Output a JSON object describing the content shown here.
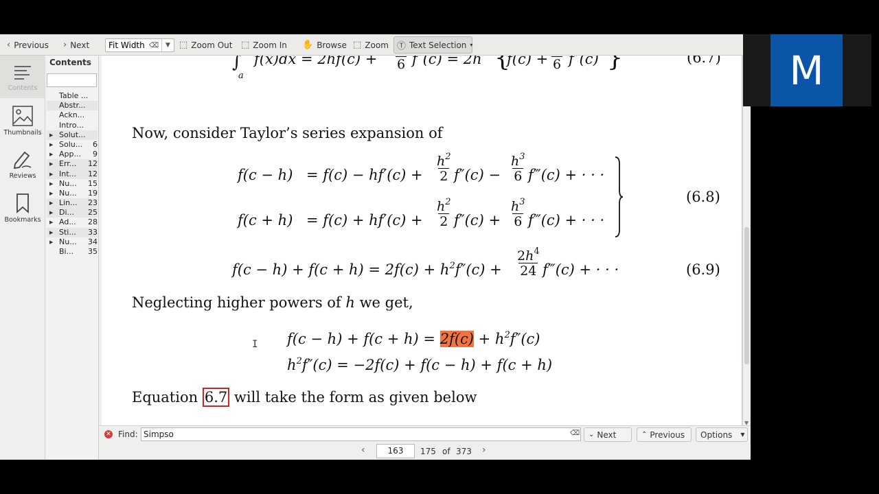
{
  "toolbar": {
    "previous": "Previous",
    "next": "Next",
    "zoom_mode": "Fit Width",
    "zoom_out": "Zoom Out",
    "zoom_in": "Zoom In",
    "browse": "Browse",
    "zoom": "Zoom",
    "text_selection": "Text Selection"
  },
  "sidebar": {
    "contents_icon_label": "Contents",
    "thumbnails": "Thumbnails",
    "reviews": "Reviews",
    "bookmarks": "Bookmarks"
  },
  "contents_panel": {
    "title": "Contents",
    "items": [
      {
        "label": "Table ...",
        "page": "",
        "expandable": false
      },
      {
        "label": "Abstr...",
        "page": "",
        "expandable": false
      },
      {
        "label": "Ackn...",
        "page": "",
        "expandable": false
      },
      {
        "label": "Intro...",
        "page": "",
        "expandable": false
      },
      {
        "label": "Solut...",
        "page": "",
        "expandable": true
      },
      {
        "label": "Solu...",
        "page": "6",
        "expandable": true
      },
      {
        "label": "App...",
        "page": "9",
        "expandable": true
      },
      {
        "label": "Err...",
        "page": "12",
        "expandable": true
      },
      {
        "label": "Int...",
        "page": "12",
        "expandable": true
      },
      {
        "label": "Nu...",
        "page": "15",
        "expandable": true
      },
      {
        "label": "Nu...",
        "page": "19",
        "expandable": true
      },
      {
        "label": "Lin...",
        "page": "23",
        "expandable": true
      },
      {
        "label": "Di...",
        "page": "25",
        "expandable": true
      },
      {
        "label": "Ad...",
        "page": "28",
        "expandable": true
      },
      {
        "label": "Sti...",
        "page": "33",
        "expandable": true
      },
      {
        "label": "Nu...",
        "page": "34",
        "expandable": true
      },
      {
        "label": "Bi...",
        "page": "35",
        "expandable": false
      }
    ]
  },
  "document": {
    "top_equation_tag": "(6.7)",
    "para1": "Now, consider Taylor’s series expansion of",
    "eq68_tag": "(6.8)",
    "eq69_tag": "(6.9)",
    "para2_a": "Neglecting higher powers of ",
    "para2_var": "h",
    "para2_b": " we get,",
    "highlight_text": "2f(c)",
    "para3_a": "Equation ",
    "para3_ref": "6.7",
    "para3_b": " will take the form as given below"
  },
  "findbar": {
    "label": "Find:",
    "query": "Simpso",
    "next": "Next",
    "previous": "Previous",
    "options": "Options"
  },
  "pagenav": {
    "current_page": "163",
    "page_label": "175",
    "of": "of",
    "total": "373"
  },
  "overlay": {
    "logo_letter": "M",
    "logo_color": "#0a55a8"
  },
  "colors": {
    "highlight": "#f2733f",
    "reference_box": "#d42222"
  }
}
